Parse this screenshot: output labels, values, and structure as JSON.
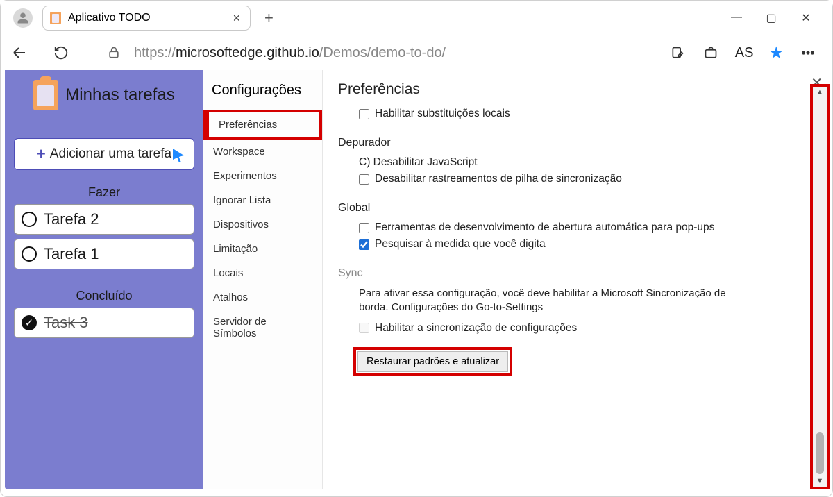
{
  "tab": {
    "title": "Aplicativo TODO"
  },
  "url": {
    "protocol": "https://",
    "host": "microsoftedge.github.io",
    "path": "/Demos/demo-to-do/"
  },
  "profile_badge": "AS",
  "todo": {
    "title": "Minhas tarefas",
    "add_label": "Adicionar uma tarefa",
    "section_todo": "Fazer",
    "section_done": "Concluído",
    "tasks_open": [
      "Tarefa 2",
      "Tarefa 1"
    ],
    "tasks_done": [
      "Task 3"
    ]
  },
  "settings_sidebar": {
    "heading": "Configurações",
    "items": [
      "Preferências",
      "Workspace",
      "Experimentos",
      "Ignorar Lista",
      "Dispositivos",
      "Limitação",
      "Locais",
      "Atalhos",
      "Servidor de Símbolos"
    ],
    "selected_index": 0
  },
  "settings": {
    "heading": "Preferências",
    "opt_local_overrides": "Habilitar substituições locais",
    "section_debugger": "Depurador",
    "opt_disable_js": "C) Desabilitar JavaScript",
    "opt_disable_async_stack": "Desabilitar rastreamentos de pilha de sincronização",
    "section_global": "Global",
    "opt_auto_open_devtools": "Ferramentas de desenvolvimento de abertura automática para pop-ups",
    "opt_search_as_type": "Pesquisar à medida que você digita",
    "section_sync": "Sync",
    "sync_note": "Para ativar essa configuração, você deve habilitar a Microsoft Sincronização de borda. Configurações do Go-to-Settings",
    "opt_enable_sync": "Habilitar a sincronização de configurações",
    "restore_label": "Restaurar padrões e atualizar"
  }
}
